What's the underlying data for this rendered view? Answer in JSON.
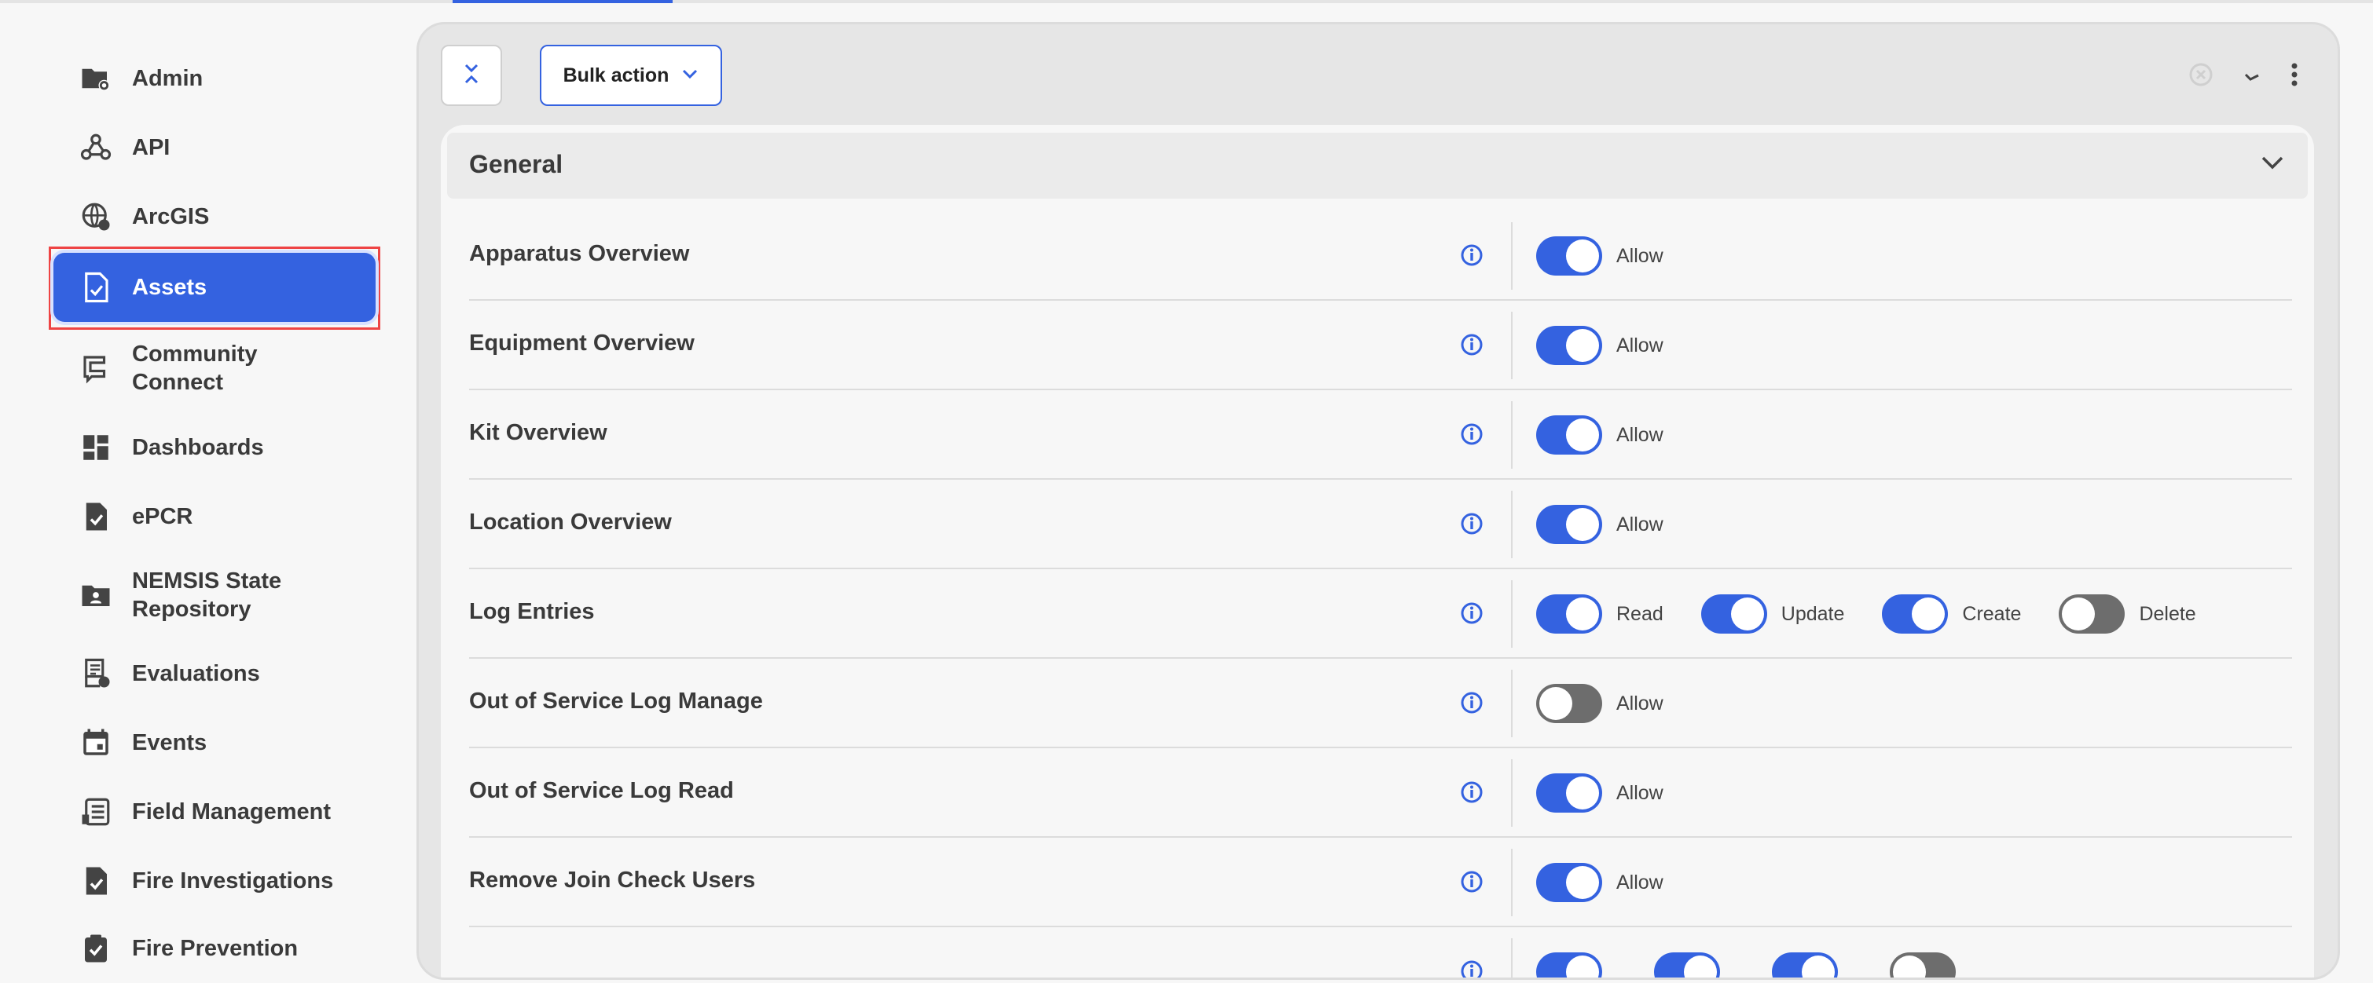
{
  "sidebar": {
    "items": [
      {
        "label": "Admin",
        "icon": "folder-gear-icon"
      },
      {
        "label": "API",
        "icon": "webhook-icon"
      },
      {
        "label": "ArcGIS",
        "icon": "globe-gear-icon"
      },
      {
        "label": "Assets",
        "icon": "document-check-icon",
        "active": true
      },
      {
        "label": "Community\nConnect",
        "icon": "community-icon"
      },
      {
        "label": "Dashboards",
        "icon": "dashboard-icon"
      },
      {
        "label": "ePCR",
        "icon": "clipboard-check-icon"
      },
      {
        "label": "NEMSIS State\nRepository",
        "icon": "folder-person-icon"
      },
      {
        "label": "Evaluations",
        "icon": "evaluation-icon"
      },
      {
        "label": "Events",
        "icon": "calendar-icon"
      },
      {
        "label": "Field Management",
        "icon": "field-list-icon"
      },
      {
        "label": "Fire Investigations",
        "icon": "document-check-icon"
      },
      {
        "label": "Fire Prevention",
        "icon": "clipboard-check-icon"
      }
    ]
  },
  "toolbar": {
    "bulk_action_label": "Bulk action"
  },
  "section": {
    "title": "General"
  },
  "permissions": [
    {
      "name": "Apparatus Overview",
      "toggles": [
        {
          "label": "Allow",
          "on": true
        }
      ]
    },
    {
      "name": "Equipment Overview",
      "toggles": [
        {
          "label": "Allow",
          "on": true
        }
      ]
    },
    {
      "name": "Kit Overview",
      "toggles": [
        {
          "label": "Allow",
          "on": true
        }
      ]
    },
    {
      "name": "Location Overview",
      "toggles": [
        {
          "label": "Allow",
          "on": true
        }
      ]
    },
    {
      "name": "Log Entries",
      "toggles": [
        {
          "label": "Read",
          "on": true
        },
        {
          "label": "Update",
          "on": true
        },
        {
          "label": "Create",
          "on": true
        },
        {
          "label": "Delete",
          "on": false
        }
      ]
    },
    {
      "name": "Out of Service Log Manage",
      "toggles": [
        {
          "label": "Allow",
          "on": false
        }
      ]
    },
    {
      "name": "Out of Service Log Read",
      "toggles": [
        {
          "label": "Allow",
          "on": true
        }
      ]
    },
    {
      "name": "Remove Join Check Users",
      "toggles": [
        {
          "label": "Allow",
          "on": true
        }
      ]
    },
    {
      "name": "",
      "toggles": [
        {
          "label": "",
          "on": true
        },
        {
          "label": "",
          "on": true
        },
        {
          "label": "",
          "on": true
        },
        {
          "label": "",
          "on": false
        }
      ]
    }
  ],
  "colors": {
    "accent": "#3462e0",
    "toggle_off": "#6d6d6d"
  }
}
